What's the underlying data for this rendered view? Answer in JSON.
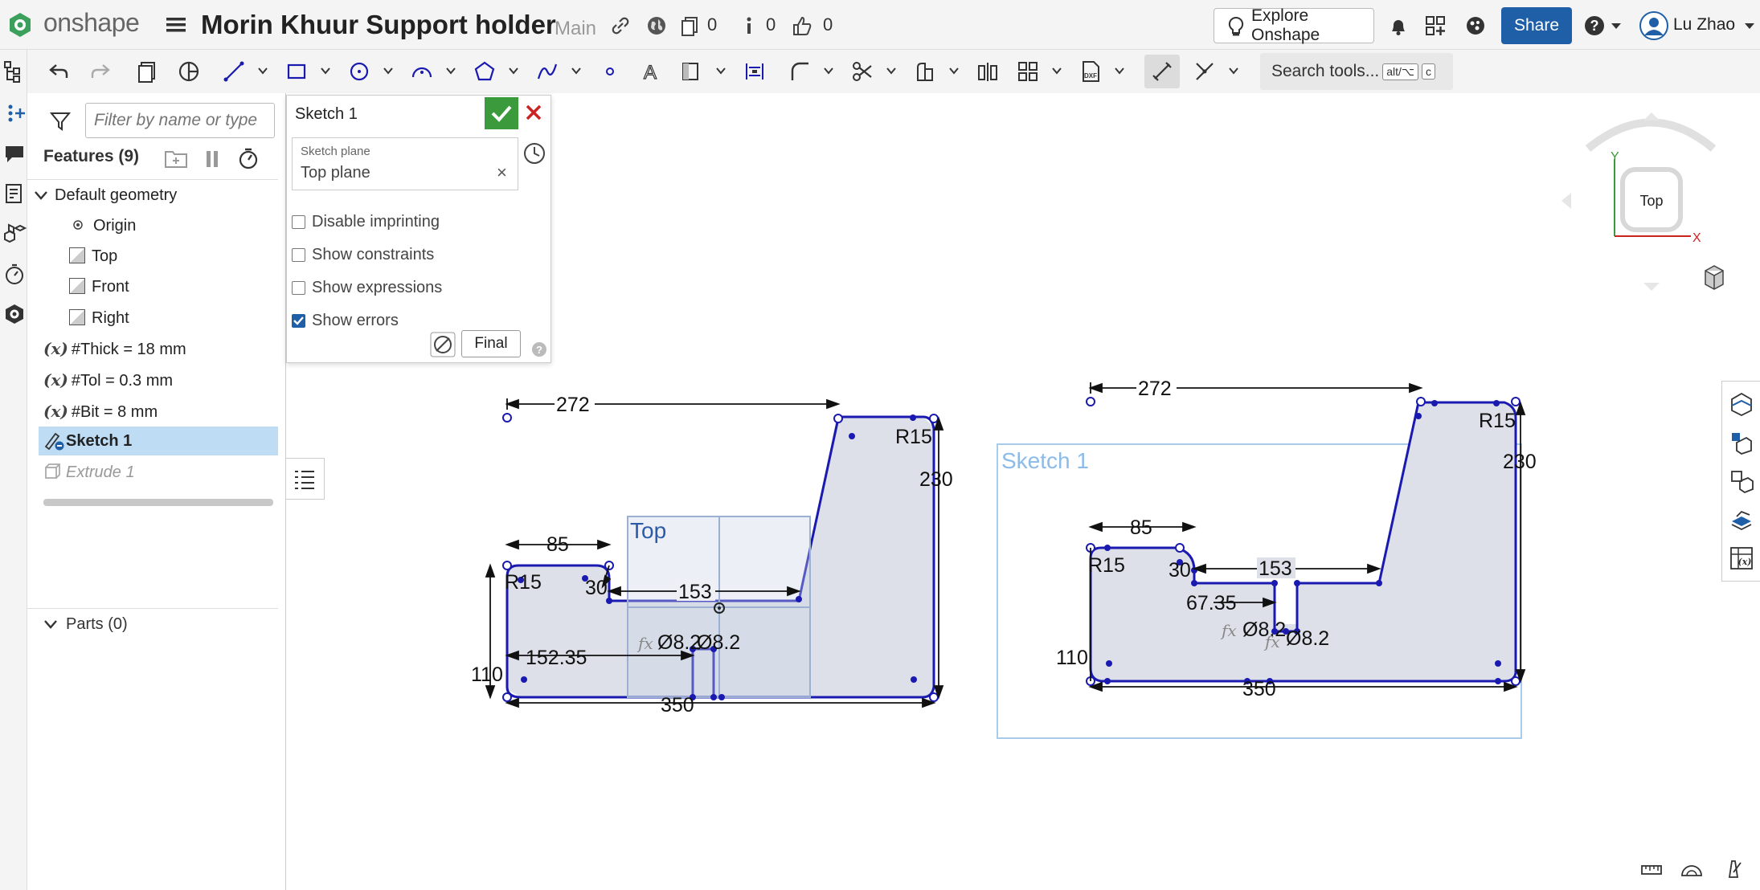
{
  "app": {
    "brand": "onshape",
    "document_title": "Morin Khuur Support holder",
    "branch": "Main",
    "counts": {
      "versions": "0",
      "info": "0",
      "likes": "0"
    },
    "explore_label": "Explore Onshape",
    "share_label": "Share",
    "user_name": "Lu Zhao"
  },
  "toolbar": {
    "search_label": "Search tools...",
    "search_shortcut_1": "alt/⌥",
    "search_shortcut_2": "c"
  },
  "feature_panel": {
    "filter_placeholder": "Filter by name or type",
    "features_header": "Features (9)",
    "items": [
      {
        "label": "Default geometry"
      },
      {
        "label": "Origin"
      },
      {
        "label": "Top"
      },
      {
        "label": "Front"
      },
      {
        "label": "Right"
      },
      {
        "label": "#Thick = 18 mm"
      },
      {
        "label": "#Tol = 0.3 mm"
      },
      {
        "label": "#Bit = 8 mm"
      },
      {
        "label": "Sketch 1"
      },
      {
        "label": "Extrude 1"
      }
    ],
    "parts_header": "Parts (0)"
  },
  "sketch_dialog": {
    "title": "Sketch 1",
    "plane_label": "Sketch plane",
    "plane_value": "Top plane",
    "options": [
      {
        "label": "Disable imprinting",
        "checked": false
      },
      {
        "label": "Show constraints",
        "checked": false
      },
      {
        "label": "Show expressions",
        "checked": false
      },
      {
        "label": "Show errors",
        "checked": true
      }
    ],
    "final_label": "Final"
  },
  "viewcube": {
    "face": "Top",
    "axis_x": "X",
    "axis_y": "Y"
  },
  "canvas": {
    "plane_label": "Top",
    "sketch_label": "Sketch 1",
    "left_dims": {
      "d272": "272",
      "d230": "230",
      "d85": "85",
      "d153": "153",
      "d30": "30",
      "r15a": "R15",
      "r15b": "R15",
      "d110": "110",
      "d152": "152.35",
      "d350": "350",
      "dia1": "Ø8.2",
      "dia2": "Ø8.2"
    },
    "right_dims": {
      "d272": "272",
      "d230": "230",
      "d85": "85",
      "d153": "153",
      "d30": "30",
      "r15a": "R15",
      "r15b": "R15",
      "d110": "110",
      "d67": "67.35",
      "d350": "350",
      "dia1": "Ø8.2",
      "dia2": "Ø8.2"
    },
    "fx": "fx"
  },
  "colors": {
    "accent": "#1f5fa8",
    "sketch_line": "#1a1ab0",
    "region_fill": "#d9dde6",
    "selected_row": "#bfdcf5",
    "ok_green": "#3a9a3c",
    "cancel_red": "#cc2222"
  }
}
